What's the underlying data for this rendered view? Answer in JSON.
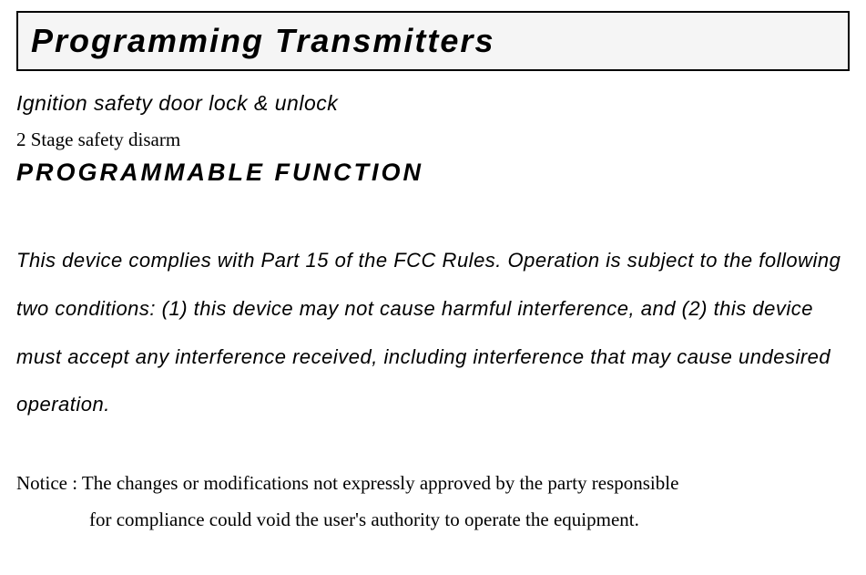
{
  "title": "Programming Transmitters",
  "line1": "Ignition safety door lock & unlock",
  "line2": "2 Stage safety disarm",
  "section_heading": "PROGRAMMABLE FUNCTION",
  "fcc_text": "This device complies with Part 15 of the FCC Rules. Operation is subject to the following two conditions: (1) this device may not cause harmful interference, and (2) this device must accept any interference received, including interference that may cause undesired operation.",
  "notice_line1": "Notice : The changes or modifications not expressly approved by the party responsible",
  "notice_line2": "for compliance could void the user's authority to operate the equipment."
}
